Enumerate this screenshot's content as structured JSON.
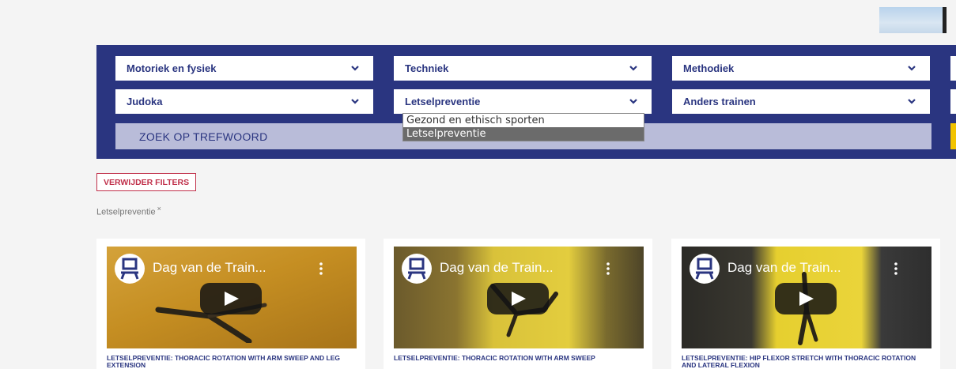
{
  "header": {
    "thumbnail_icon": "landscape-thumbnail"
  },
  "filters": {
    "row1": [
      {
        "label": "Motoriek en fysiek"
      },
      {
        "label": "Techniek"
      },
      {
        "label": "Methodiek"
      }
    ],
    "row2": [
      {
        "label": "Judoka"
      },
      {
        "label": "Letselpreventie"
      },
      {
        "label": "Anders trainen"
      }
    ],
    "search_placeholder": "ZOEK OP TREFWOORD",
    "dropdown_open": {
      "options": [
        "Gezond en ethisch sporten",
        "Letselpreventie"
      ],
      "selected": "Letselpreventie"
    }
  },
  "clear_filters_label": "VERWIJDER FILTERS",
  "active_filter": {
    "label": "Letselpreventie",
    "remove_symbol": "×"
  },
  "cards": [
    {
      "video_title": "Dag van de Train...",
      "title": "LETSELPREVENTIE: THORACIC ROTATION WITH ARM SWEEP AND LEG EXTENSION"
    },
    {
      "video_title": "Dag van de Train...",
      "title": "LETSELPREVENTIE: THORACIC ROTATION WITH ARM SWEEP"
    },
    {
      "video_title": "Dag van de Train...",
      "title": "LETSELPREVENTIE: HIP FLEXOR STRETCH WITH THORACIC ROTATION AND LATERAL FLEXION"
    }
  ],
  "colors": {
    "brand_blue": "#2a3580",
    "accent_red": "#c0304a",
    "accent_yellow": "#f2c300"
  }
}
